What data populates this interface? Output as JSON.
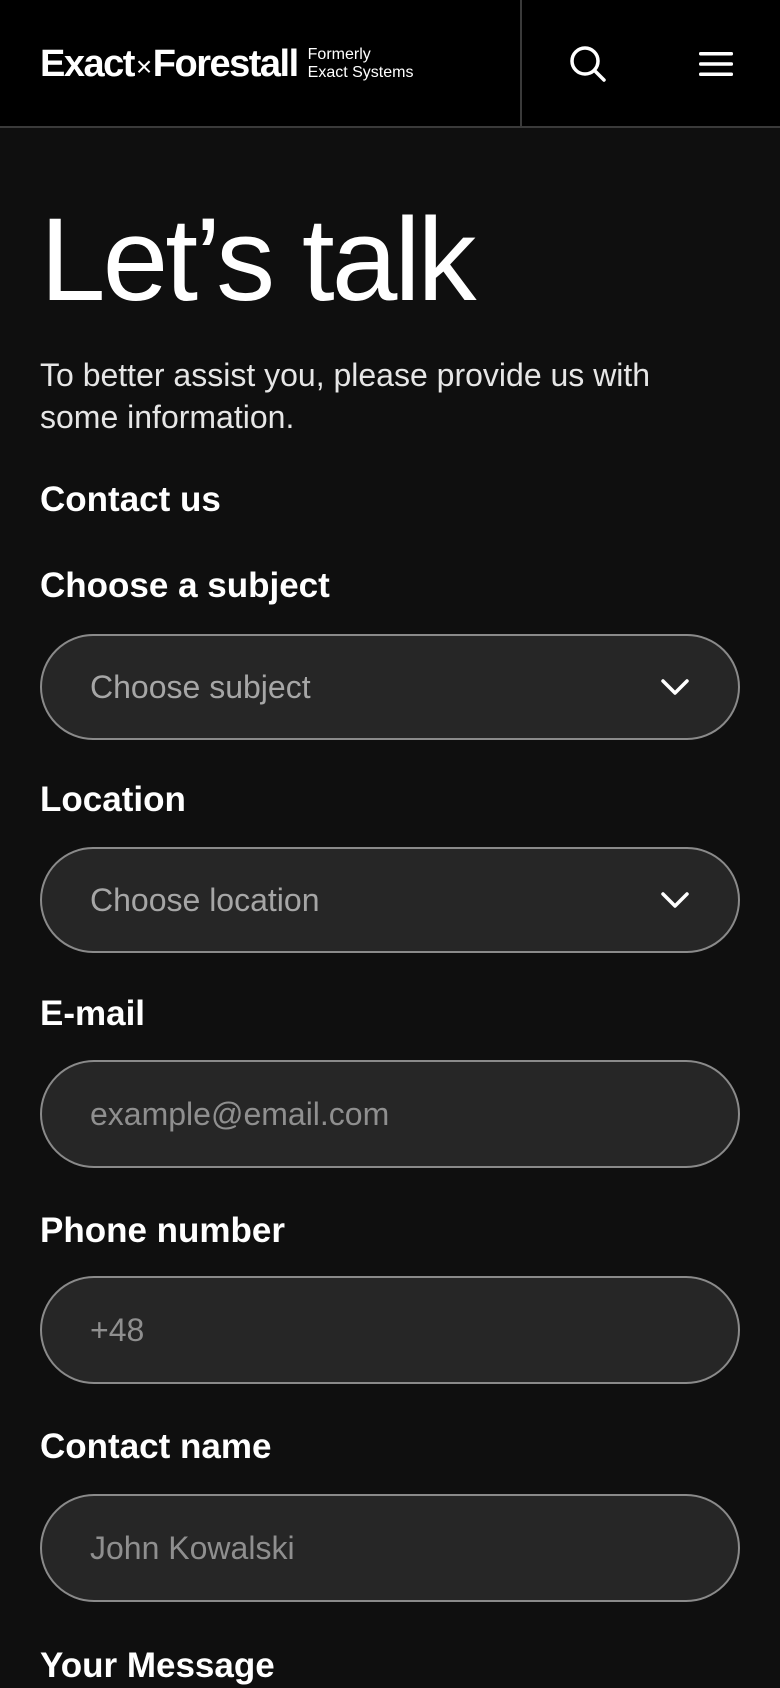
{
  "header": {
    "logo": {
      "left": "Exact",
      "right": "Forestall",
      "sub_line1": "Formerly",
      "sub_line2": "Exact Systems"
    },
    "search_icon": "search-icon",
    "menu_icon": "hamburger-menu-icon"
  },
  "hero": {
    "title": "Let’s talk",
    "intro": "To better assist you, please provide us with some information."
  },
  "form": {
    "section_heading": "Contact us",
    "subject": {
      "label": "Choose a subject",
      "value": "Choose subject"
    },
    "location": {
      "label": "Location",
      "value": "Choose location"
    },
    "email": {
      "label": "E-mail",
      "placeholder": "example@email.com"
    },
    "phone": {
      "label": "Phone number",
      "placeholder": "+48"
    },
    "name": {
      "label": "Contact name",
      "placeholder": "John Kowalski"
    },
    "message": {
      "label": "Your Message"
    }
  },
  "colors": {
    "background": "#0f0f0f",
    "header": "#000000",
    "field_fill": "#262626",
    "field_border": "#8a8a8a",
    "placeholder": "#a6a6a6"
  }
}
